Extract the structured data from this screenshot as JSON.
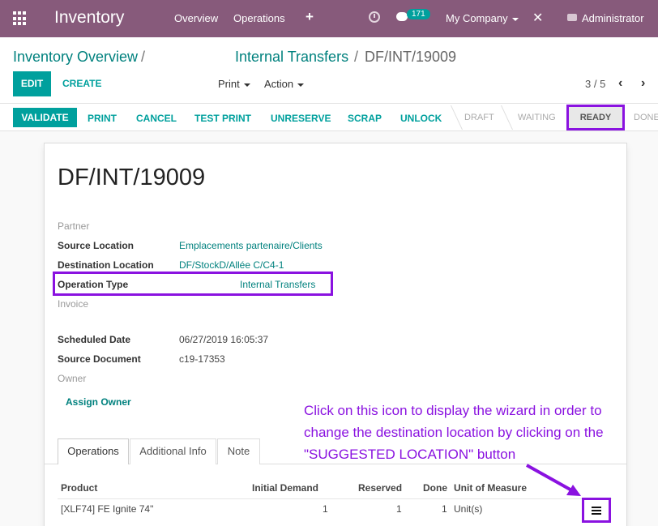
{
  "navbar": {
    "app_name": "Inventory",
    "menu": [
      "Overview",
      "Operations"
    ],
    "plus": "+",
    "messages_count": "171",
    "company": "My Company",
    "tools": "✕",
    "user": "Administrator"
  },
  "breadcrumb": {
    "parent": "Inventory Overview",
    "sep": "/",
    "middle": "Internal Transfers",
    "current": "DF/INT/19009"
  },
  "control": {
    "edit": "EDIT",
    "create": "CREATE",
    "print": "Print",
    "action": "Action",
    "pager": "3 / 5",
    "prev": "‹",
    "next": "›"
  },
  "statusbar": {
    "validate": "VALIDATE",
    "buttons": [
      "PRINT",
      "CANCEL",
      "TEST PRINT",
      "UNRESERVE",
      "SCRAP",
      "UNLOCK"
    ],
    "stages": [
      "DRAFT",
      "WAITING",
      "READY",
      "DONE"
    ]
  },
  "record": {
    "title": "DF/INT/19009",
    "partner_label": "Partner",
    "source_location_label": "Source Location",
    "source_location": "Emplacements partenaire/Clients",
    "dest_location_label": "Destination Location",
    "dest_location": "DF/StockD/Allée C/C4-1",
    "operation_type_label": "Operation Type",
    "operation_type": "Internal Transfers",
    "invoice_label": "Invoice",
    "scheduled_date_label": "Scheduled Date",
    "scheduled_date": "06/27/2019 16:05:37",
    "source_document_label": "Source Document",
    "source_document": "c19-17353",
    "owner_label": "Owner",
    "assign_owner": "Assign Owner"
  },
  "annotation": "Click on this icon to display the wizard in order to change the destination location by clicking on the \"SUGGESTED LOCATION\" button",
  "tabs": [
    "Operations",
    "Additional Info",
    "Note"
  ],
  "table": {
    "headers": [
      "Product",
      "Initial Demand",
      "Reserved",
      "Done",
      "Unit of Measure"
    ],
    "rows": [
      {
        "product": "[XLF74] FE Ignite 74\"",
        "initial_demand": "1",
        "reserved": "1",
        "done": "1",
        "uom": "Unit(s)"
      }
    ]
  },
  "colors": {
    "navbar": "#875a7b",
    "primary": "#00a09d",
    "link": "#00817e",
    "highlight": "#8a12e0"
  }
}
